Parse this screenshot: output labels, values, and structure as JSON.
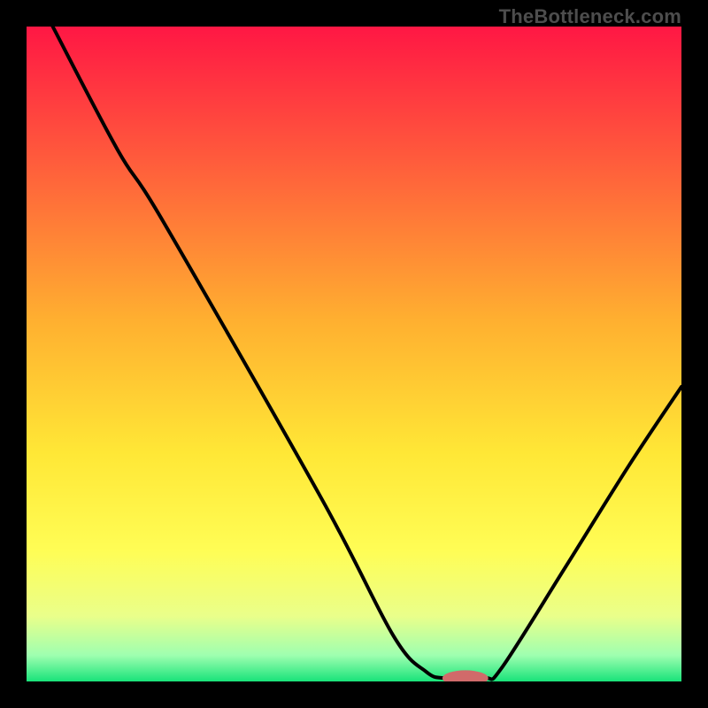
{
  "watermark": "TheBottleneck.com",
  "accent_marker_color": "#d16a6a",
  "curve_color": "#000000",
  "chart_data": {
    "type": "line",
    "title": "",
    "xlabel": "",
    "ylabel": "",
    "xlim": [
      0,
      100
    ],
    "ylim": [
      0,
      100
    ],
    "grid": false,
    "legend": false,
    "gradient_stops": [
      {
        "offset": 0.0,
        "color": "#ff1744"
      },
      {
        "offset": 0.2,
        "color": "#ff5a3c"
      },
      {
        "offset": 0.45,
        "color": "#ffb030"
      },
      {
        "offset": 0.65,
        "color": "#ffe736"
      },
      {
        "offset": 0.8,
        "color": "#fffd55"
      },
      {
        "offset": 0.9,
        "color": "#eaff8a"
      },
      {
        "offset": 0.96,
        "color": "#9fffb0"
      },
      {
        "offset": 1.0,
        "color": "#19e37a"
      }
    ],
    "series": [
      {
        "name": "bottleneck-curve",
        "points": [
          {
            "x": 4.0,
            "y": 100.0
          },
          {
            "x": 14.0,
            "y": 81.0
          },
          {
            "x": 21.0,
            "y": 70.0
          },
          {
            "x": 45.0,
            "y": 28.0
          },
          {
            "x": 56.0,
            "y": 7.0
          },
          {
            "x": 61.0,
            "y": 1.5
          },
          {
            "x": 64.0,
            "y": 0.5
          },
          {
            "x": 70.0,
            "y": 0.5
          },
          {
            "x": 72.5,
            "y": 2.0
          },
          {
            "x": 82.0,
            "y": 17.0
          },
          {
            "x": 92.0,
            "y": 33.0
          },
          {
            "x": 100.0,
            "y": 45.0
          }
        ]
      }
    ],
    "marker": {
      "x": 67.0,
      "y": 0.5,
      "rx": 3.5,
      "ry": 1.2
    }
  }
}
